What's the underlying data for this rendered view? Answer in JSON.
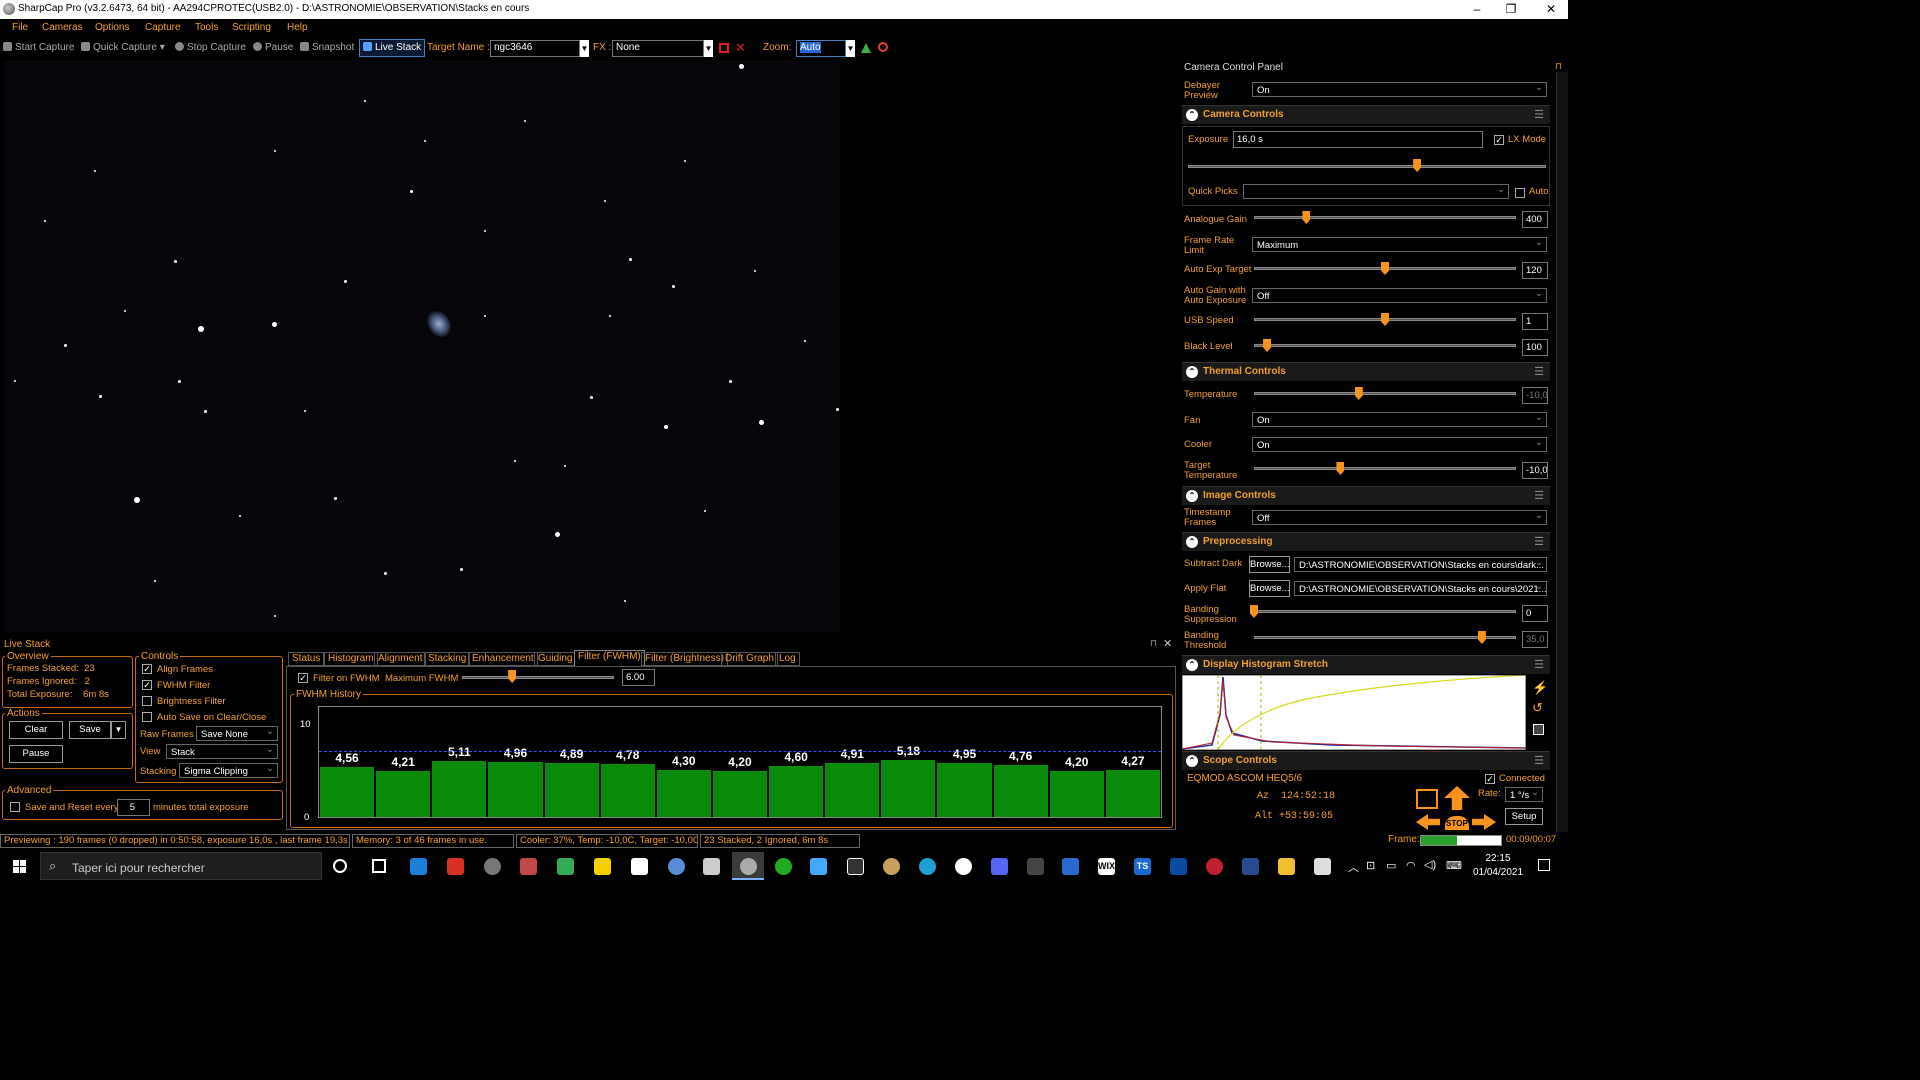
{
  "window": {
    "title": "SharpCap Pro (v3.2.6473, 64 bit) - AA294CPROTEC(USB2.0) - D:\\ASTRONOMIE\\OBSERVATION\\Stacks en cours",
    "minimize": "–",
    "maximize": "❐",
    "close": "✕"
  },
  "menu": [
    "File",
    "Cameras",
    "Options",
    "Capture",
    "Tools",
    "Scripting",
    "Help"
  ],
  "toolbar": {
    "start_capture": "Start Capture",
    "quick_capture": "Quick Capture",
    "stop_capture": "Stop Capture",
    "pause": "Pause",
    "snapshot": "Snapshot",
    "live_stack": "Live Stack",
    "target_label": "Target Name :",
    "target_value": "ngc3646",
    "fx_label": "FX :",
    "fx_value": "None",
    "zoom_label": "Zoom:",
    "zoom_value": "Auto"
  },
  "camera_panel": {
    "title": "Camera Control Panel",
    "pin": "⊓",
    "debayer_label": "Debayer Preview",
    "debayer_value": "On",
    "camera_controls": {
      "title": "Camera Controls",
      "exposure_label": "Exposure",
      "exposure_value": "16,0 s",
      "lx_mode_label": "LX Mode",
      "lx_mode_checked": true,
      "exposure_level": 0.64,
      "quick_picks_label": "Quick Picks",
      "quick_picks_value": "",
      "auto_label": "Auto",
      "analogue_gain_label": "Analogue Gain",
      "analogue_gain_value": "400",
      "analogue_gain_level": 0.2,
      "frame_rate_label": "Frame Rate Limit",
      "frame_rate_value": "Maximum",
      "auto_exp_target_label": "Auto Exp Target",
      "auto_exp_target_value": "120",
      "auto_exp_target_level": 0.5,
      "auto_gain_label": "Auto Gain with Auto Exposure",
      "auto_gain_value": "Off",
      "usb_speed_label": "USB Speed",
      "usb_speed_value": "1",
      "usb_speed_level": 0.5,
      "black_level_label": "Black Level",
      "black_level_value": "100",
      "black_level_level": 0.05
    },
    "thermal_controls": {
      "title": "Thermal Controls",
      "temperature_label": "Temperature",
      "temperature_value": "-10,0",
      "temperature_level": 0.4,
      "fan_label": "Fan",
      "fan_value": "On",
      "cooler_label": "Cooler",
      "cooler_value": "On",
      "target_temp_label": "Target Temperature",
      "target_temp_value": "-10,0",
      "target_temp_level": 0.33
    },
    "image_controls": {
      "title": "Image Controls",
      "timestamp_label": "Timestamp Frames",
      "timestamp_value": "Off"
    },
    "preprocessing": {
      "title": "Preprocessing",
      "subtract_dark_label": "Subtract Dark",
      "browse_label": "Browse...",
      "subtract_dark_value": "D:\\ASTRONOMIE\\OBSERVATION\\Stacks en cours\\dark...",
      "apply_flat_label": "Apply Flat",
      "apply_flat_value": "D:\\ASTRONOMIE\\OBSERVATION\\Stacks en cours\\2021...",
      "banding_suppression_label": "Banding Suppression",
      "banding_suppression_value": "0",
      "banding_suppression_level": 0.0,
      "banding_threshold_label": "Banding Threshold",
      "banding_threshold_value": "35,0",
      "banding_threshold_level": 0.87
    },
    "histogram": {
      "title": "Display Histogram Stretch"
    },
    "scope_controls": {
      "title": "Scope Controls",
      "mount": "EQMOD ASCOM HEQ5/6",
      "connected_label": "Connected",
      "az": "Az  124:52:18",
      "alt": "Alt +53:59:05",
      "rate_label": "Rate:",
      "rate_value": "1 °/s",
      "setup_label": "Setup",
      "stop_label": "STOP"
    }
  },
  "live_stack": {
    "title": "Live Stack",
    "overview_title": "Overview",
    "frames_stacked": "Frames Stacked:  23",
    "frames_ignored": "Frames Ignored:   2",
    "total_exposure": "Total Exposure:    6m 8s",
    "actions_title": "Actions",
    "clear_label": "Clear",
    "save_label": "Save",
    "pause_label": "Pause",
    "advanced_title": "Advanced",
    "save_reset_label": "Save and Reset every",
    "save_reset_value": "5",
    "minutes_label": "minutes total exposure",
    "controls_title": "Controls",
    "align_frames": "Align Frames",
    "fwhm_filter": "FWHM Filter",
    "brightness_filter": "Brightness Filter",
    "auto_save": "Auto Save on Clear/Close",
    "raw_frames_label": "Raw Frames",
    "raw_frames_value": "Save None",
    "view_label": "View",
    "view_value": "Stack",
    "stacking_label": "Stacking",
    "stacking_value": "Sigma Clipping",
    "tabs": [
      "Status",
      "Histogram",
      "Alignment",
      "Stacking",
      "Enhancement",
      "Guiding",
      "Filter (FWHM)",
      "Filter (Brightness)",
      "Drift Graph",
      "Log"
    ],
    "filter_on_fwhm": "Filter on FWHM",
    "max_fwhm_label": "Maximum FWHM",
    "max_fwhm_value": "6.00",
    "max_fwhm_level": 0.33,
    "fwhm_history_title": "FWHM History",
    "y_top": "10",
    "y_bottom": "0"
  },
  "chart_data": {
    "type": "bar",
    "title": "FWHM History",
    "ylim": [
      0,
      10
    ],
    "threshold": 6.0,
    "labels": [
      "4,56",
      "4,21",
      "5,11",
      "4,96",
      "4,89",
      "4,78",
      "4,30",
      "4,20",
      "4,60",
      "4,91",
      "5,18",
      "4,95",
      "4,76",
      "4,20",
      "4,27"
    ],
    "values": [
      4.56,
      4.21,
      5.11,
      4.96,
      4.89,
      4.78,
      4.3,
      4.2,
      4.6,
      4.91,
      5.18,
      4.95,
      4.76,
      4.2,
      4.27
    ]
  },
  "status": {
    "preview": "Previewing : 190 frames (0 dropped) in 0:50:58, exposure 16,0s , last frame 19,3s",
    "memory": "Memory: 3 of 46 frames in use.",
    "cooler": "Cooler: 37%, Temp: -10,0C, Target: -10,0C",
    "stacked": "23 Stacked, 2 Ignored, 6m 8s",
    "frame_label": "Frame:",
    "frame_progress": 0.45,
    "frame_time": "00:09/00:07"
  },
  "taskbar": {
    "search_placeholder": "Taper ici pour rechercher",
    "time": "22:15",
    "date": "01/04/2021"
  }
}
